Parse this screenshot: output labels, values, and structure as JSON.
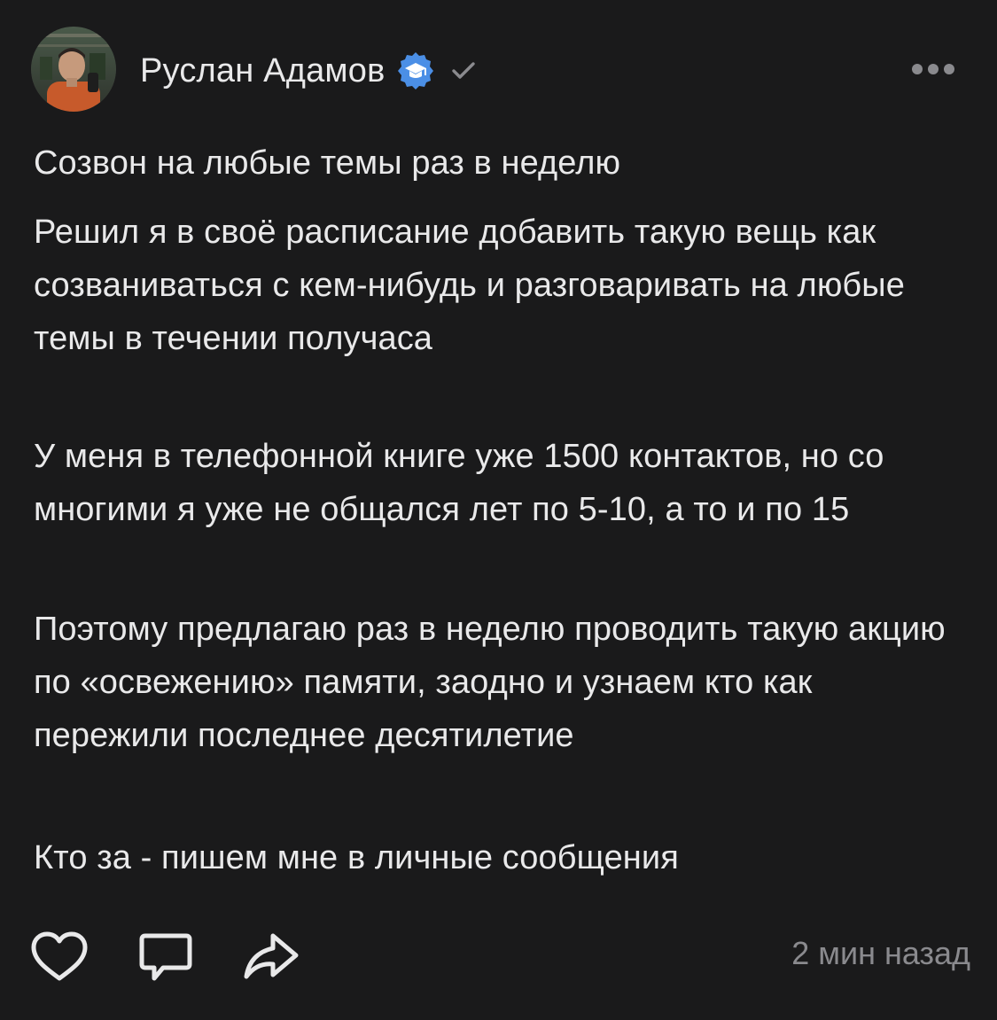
{
  "author": {
    "name": "Руслан Адамов",
    "verified_icon": "graduation-cap-badge-icon",
    "check_icon": "checkmark-icon"
  },
  "post": {
    "title": "Созвон на любые темы раз в неделю",
    "paragraphs": [
      "Решил я в своё расписание добавить такую вещь как созваниваться с кем-нибудь и разговаривать на любые темы в течении получаса",
      "У меня в телефонной книге уже 1500 контактов, но со многими я уже не общался лет по 5-10, а то и по 15",
      "Поэтому предлагаю раз в неделю проводить такую акцию по «освежению» памяти, заодно и узнаем кто как пережили последнее десятилетие",
      "Кто за - пишем мне в личные сообщения"
    ]
  },
  "footer": {
    "timestamp": "2 мин назад"
  },
  "colors": {
    "background": "#1a1a1b",
    "text": "#e9e9ea",
    "muted": "#8a8a8e",
    "badge": "#4b8fe6"
  }
}
